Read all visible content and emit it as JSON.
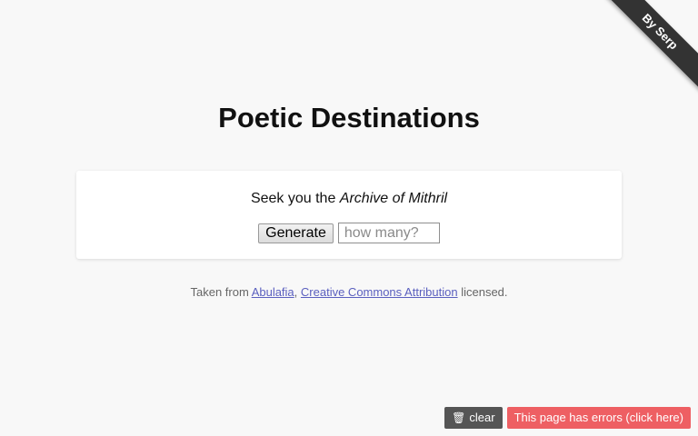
{
  "ribbon": {
    "label": "By Serp"
  },
  "page": {
    "title": "Poetic Destinations"
  },
  "card": {
    "seek_prefix": "Seek you the ",
    "seek_title": "Archive of Mithril",
    "generate_label": "Generate",
    "count_placeholder": "how many?"
  },
  "credits": {
    "prefix": "Taken from ",
    "source_link": "Abulafia",
    "separator": ", ",
    "license_link": "Creative Commons Attribution",
    "suffix": " licensed."
  },
  "status_bar": {
    "clear_icon": "trash-icon",
    "clear_label": "clear",
    "error_label": "This page has errors (click here)"
  },
  "colors": {
    "error_badge": "#ee5f63",
    "clear_badge": "#555555",
    "link": "#5a5fbf",
    "ribbon": "#333333"
  }
}
